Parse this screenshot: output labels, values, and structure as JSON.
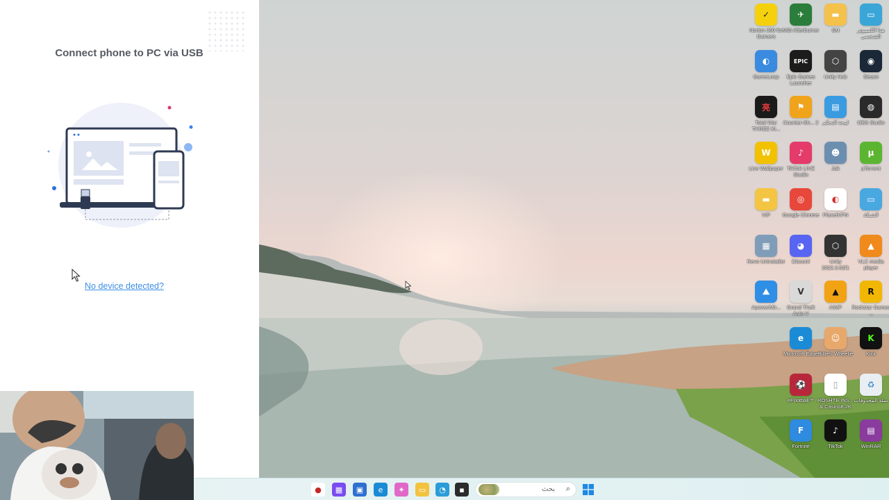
{
  "app": {
    "title": "Connect phone to PC via USB",
    "help_link": "No device detected?"
  },
  "taskbar": {
    "search_placeholder": "بحث",
    "pinned": [
      {
        "name": "app-icon",
        "bg": "#ffffff",
        "glyph": "●"
      },
      {
        "name": "gallery-icon",
        "bg": "#7a4cf0",
        "glyph": "▦"
      },
      {
        "name": "store-icon",
        "bg": "#2f6fd0",
        "glyph": "▣"
      },
      {
        "name": "edge-icon",
        "bg": "#1b8bd6",
        "glyph": "e"
      },
      {
        "name": "copilot-icon",
        "bg": "#e069c8",
        "glyph": "✦"
      },
      {
        "name": "file-explorer-icon",
        "bg": "#f3c23e",
        "glyph": "▭"
      },
      {
        "name": "browser-icon",
        "bg": "#2a9cd8",
        "glyph": "◔"
      },
      {
        "name": "terminal-icon",
        "bg": "#2b2b2b",
        "glyph": "▪"
      }
    ]
  },
  "desktop_icons": [
    [
      {
        "label": "Norton 360 for Gamers",
        "bg": "#f5d10d",
        "glyph": "✓",
        "fg": "#222"
      },
      {
        "label": "MSI Afterburner",
        "bg": "#2a7d3a",
        "glyph": "✈"
      },
      {
        "label": "SM",
        "bg": "#f4c14a",
        "glyph": "▬"
      },
      {
        "label": "هذا الكمبيوتر الشخصي",
        "bg": "#3aa6d8",
        "glyph": "▭"
      }
    ],
    [
      {
        "label": "GameLoop",
        "bg": "#3a8be0",
        "glyph": "◐"
      },
      {
        "label": "Epic Games Launcher",
        "bg": "#1c1c1c",
        "glyph": "EPIC"
      },
      {
        "label": "Unity Hub",
        "bg": "#444444",
        "glyph": "⬡"
      },
      {
        "label": "Steam",
        "bg": "#1b2838",
        "glyph": "◉"
      }
    ],
    [
      {
        "label": "Total War THREE KI...",
        "bg": "#1a1a1a",
        "glyph": "亮",
        "fg": "#e23a3a"
      },
      {
        "label": "Counter-Str... 2",
        "bg": "#f0a41c",
        "glyph": "⚑"
      },
      {
        "label": "لوحة التحكم",
        "bg": "#3a9be0",
        "glyph": "▤"
      },
      {
        "label": "OBS Studio",
        "bg": "#2a2a2a",
        "glyph": "◍"
      }
    ],
    [
      {
        "label": "Live Wallpaper",
        "bg": "#f2c200",
        "glyph": "W"
      },
      {
        "label": "TikTok LIVE Studio",
        "bg": "#e43b6a",
        "glyph": "♪"
      },
      {
        "label": "Jak",
        "bg": "#6c8fb0",
        "glyph": "☻"
      },
      {
        "label": "µTorrent",
        "bg": "#5cb531",
        "glyph": "µ"
      }
    ],
    [
      {
        "label": "VIP",
        "bg": "#f4c542",
        "glyph": "▬"
      },
      {
        "label": "Google Chrome",
        "bg": "#e7483b",
        "glyph": "◎"
      },
      {
        "label": "PlanetVPN",
        "bg": "#ffffff",
        "glyph": "◐",
        "fg": "#d3302e"
      },
      {
        "label": "الشبكة",
        "bg": "#4aa8e0",
        "glyph": "▭"
      }
    ],
    [
      {
        "label": "Revo Uninstaller",
        "bg": "#7f9db9",
        "glyph": "▦"
      },
      {
        "label": "Discord",
        "bg": "#5865f2",
        "glyph": "◕"
      },
      {
        "label": "Unity 2022.3.62f1",
        "bg": "#333333",
        "glyph": "⬡"
      },
      {
        "label": "VLC media player",
        "bg": "#f08a1c",
        "glyph": "▲"
      }
    ],
    [
      {
        "label": "ApowerMir...",
        "bg": "#2f8ee5",
        "glyph": "⛰"
      },
      {
        "label": "Grand Theft Auto V",
        "bg": "#d9d9d9",
        "glyph": "V",
        "fg": "#333"
      },
      {
        "label": "AIMP",
        "bg": "#f2a313",
        "glyph": "▲",
        "fg": "#111"
      },
      {
        "label": "Rockstar Games ...",
        "bg": "#f2b705",
        "glyph": "R",
        "fg": "#111"
      }
    ],
    [
      {
        "label": "",
        "bg": "transparent",
        "glyph": ""
      },
      {
        "label": "Microsoft Edge",
        "bg": "#1b8bd6",
        "glyph": "e"
      },
      {
        "label": "Billie's Wheelie",
        "bg": "#e8a86b",
        "glyph": "☺"
      },
      {
        "label": "Kick",
        "bg": "#111111",
        "glyph": "K",
        "fg": "#53fc18"
      }
    ],
    [
      {
        "label": "",
        "bg": "transparent",
        "glyph": ""
      },
      {
        "label": "eFootball™",
        "bg": "#b8263a",
        "glyph": "⚽"
      },
      {
        "label": "ROSHTE INS... & Casino8.2K",
        "bg": "#ffffff",
        "glyph": "▯",
        "fg": "#999"
      },
      {
        "label": "سلة المحذوفات",
        "bg": "#e8eef2",
        "glyph": "♻",
        "fg": "#4a90c8"
      }
    ],
    [
      {
        "label": "",
        "bg": "transparent",
        "glyph": ""
      },
      {
        "label": "Fortnite",
        "bg": "#2e8be0",
        "glyph": "F"
      },
      {
        "label": "TikTok",
        "bg": "#111111",
        "glyph": "♪"
      },
      {
        "label": "WinRAR",
        "bg": "#8a3b9e",
        "glyph": "▤"
      }
    ]
  ]
}
